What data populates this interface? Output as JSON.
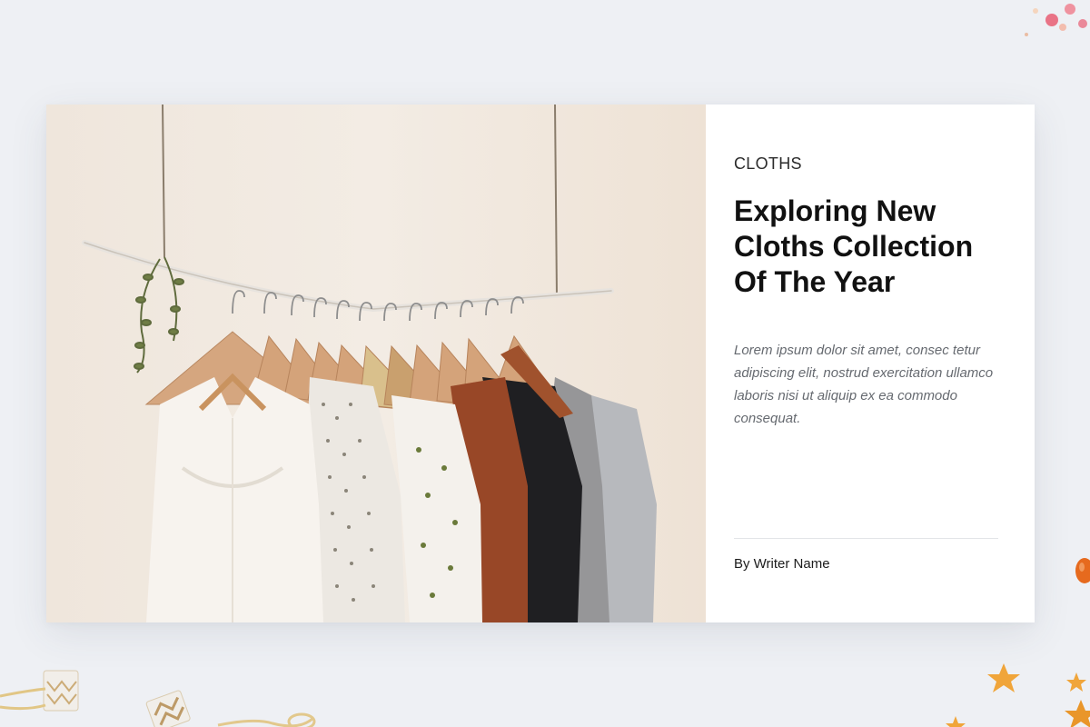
{
  "post": {
    "category": "CLOTHS",
    "title": "Exploring New Cloths Collection Of The Year",
    "excerpt": "Lorem ipsum dolor sit amet, consec tetur adipiscing elit, nostrud exercitation ullamco laboris nisi ut aliquip ex ea commodo consequat.",
    "byline": "By Writer Name",
    "image_icon": "clothing-rack-photo"
  },
  "colors": {
    "background": "#eef0f4",
    "card": "#ffffff",
    "title": "#111111",
    "excerpt": "#666a70"
  }
}
